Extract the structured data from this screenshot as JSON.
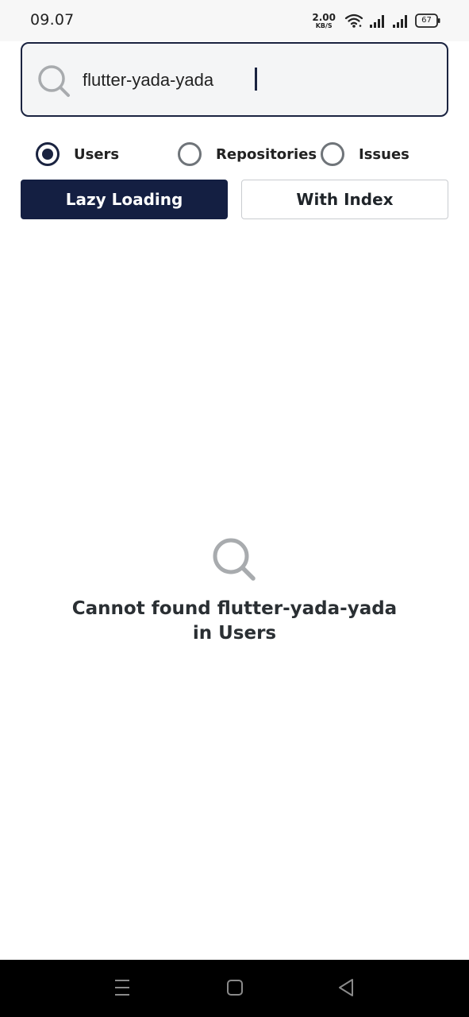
{
  "status_bar": {
    "time": "09.07",
    "net_speed_value": "2.00",
    "net_speed_unit": "KB/S",
    "battery": "67",
    "icons": [
      "wifi-icon",
      "signal-icon",
      "signal-icon",
      "battery-icon"
    ]
  },
  "search": {
    "value": "flutter-yada-yada",
    "icon": "search-icon"
  },
  "filters": {
    "options": [
      {
        "label": "Users",
        "checked": true
      },
      {
        "label": "Repositories",
        "checked": false
      },
      {
        "label": "Issues",
        "checked": false
      }
    ]
  },
  "modes": {
    "lazy_label": "Lazy Loading",
    "index_label": "With Index",
    "active": "Lazy Loading"
  },
  "empty_state": {
    "icon": "search-icon",
    "line1": "Cannot found flutter-yada-yada",
    "line2": "in Users"
  },
  "nav_bar": {
    "icons": [
      "recents-icon",
      "home-icon",
      "back-icon"
    ]
  },
  "colors": {
    "primary": "#141f42",
    "outline": "#1a2340",
    "muted": "#6f7479",
    "icon_gray": "#a8abae"
  }
}
